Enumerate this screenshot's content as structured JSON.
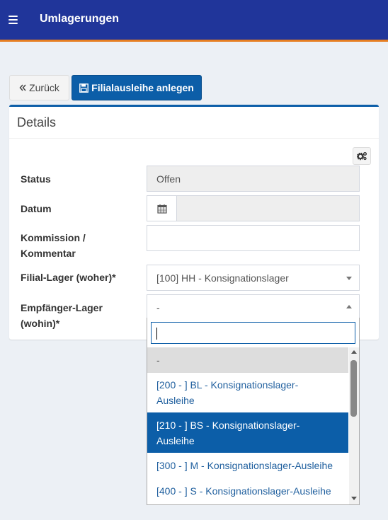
{
  "header": {
    "title": "Umlagerungen",
    "bar_color": "#20359a",
    "accent_color": "#e67e22"
  },
  "toolbar": {
    "back_label": "Zurück",
    "create_label": "Filialausleihe anlegen"
  },
  "box": {
    "title": "Details"
  },
  "form": {
    "status_label": "Status",
    "status_value": "Offen",
    "datum_label": "Datum",
    "kommission_label_1": "Kommission /",
    "kommission_label_2": "Kommentar",
    "filial_label": "Filial-Lager (woher)*",
    "filial_value": "[100] HH - Konsignationslager",
    "empfaenger_label_1": "Empfänger-Lager",
    "empfaenger_label_2": "(wohin)*",
    "empfaenger_value": "-"
  },
  "dropdown": {
    "search_value": "",
    "options": [
      {
        "line1": "-",
        "line2": "",
        "state": "placeholder"
      },
      {
        "line1": "[200 - ] BL - Konsignationslager-",
        "line2": "Ausleihe",
        "state": "normal"
      },
      {
        "line1": "[210 - ] BS - Konsignationslager-",
        "line2": "Ausleihe",
        "state": "selected"
      },
      {
        "line1": "[300 - ] M - Konsignationslager-Ausleihe",
        "line2": "",
        "state": "normal"
      },
      {
        "line1": "[400 - ] S - Konsignationslager-Ausleihe",
        "line2": "",
        "state": "normal"
      }
    ]
  },
  "icons": {
    "menu": "hamburger-icon",
    "back": "double-chevron-left-icon",
    "create": "floppy-disk-icon",
    "settings": "gears-icon",
    "calendar": "calendar-icon"
  }
}
